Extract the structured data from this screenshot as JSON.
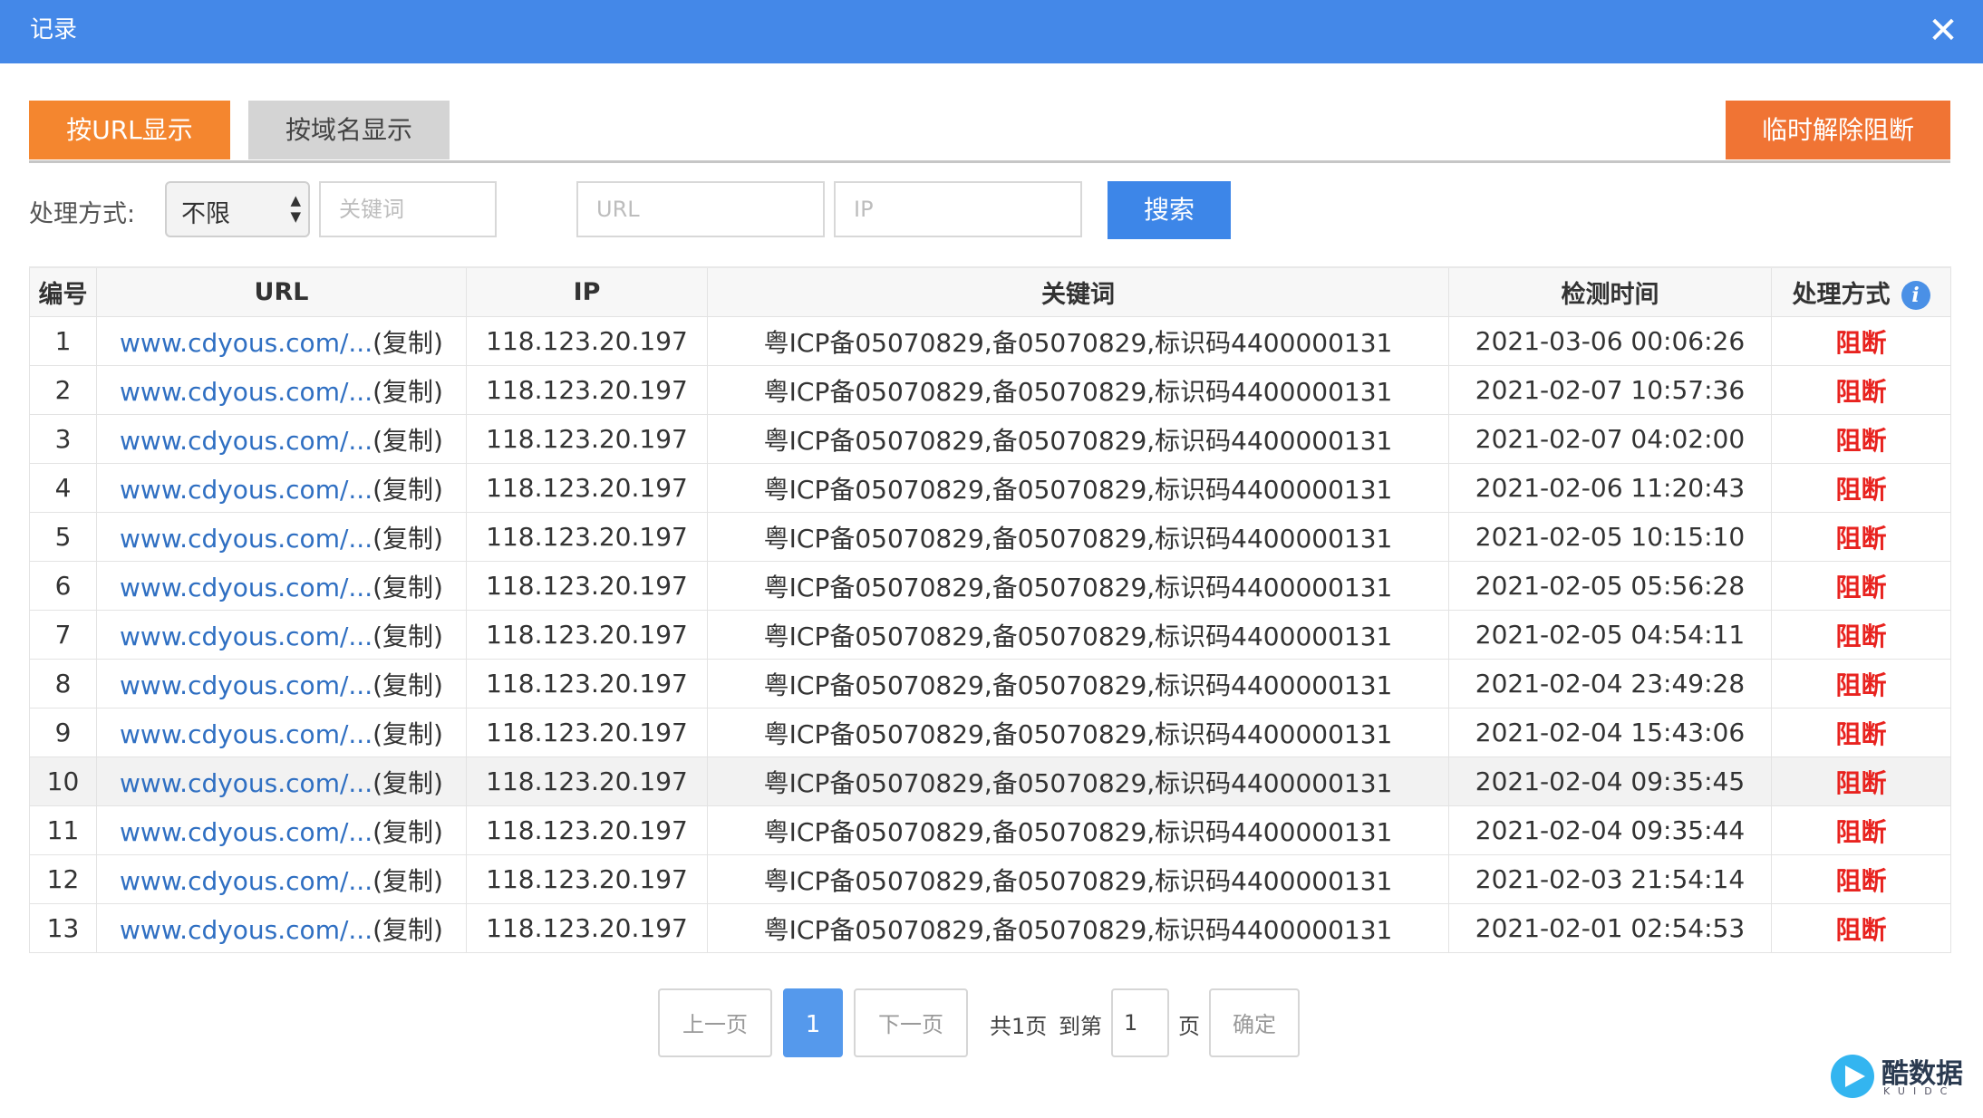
{
  "dialog": {
    "title": "记录",
    "close_icon": "close-icon"
  },
  "tabs": [
    {
      "label": "按URL显示",
      "active": true
    },
    {
      "label": "按域名显示",
      "active": false
    }
  ],
  "unblock_label": "临时解除阻断",
  "filters": {
    "label": "处理方式:",
    "select_value": "不限",
    "keyword_placeholder": "关键词",
    "url_placeholder": "URL",
    "ip_placeholder": "IP",
    "search_label": "搜索"
  },
  "table": {
    "columns": [
      "编号",
      "URL",
      "IP",
      "关键词",
      "检测时间",
      "处理方式"
    ],
    "info_icon": "info-icon",
    "rows": [
      {
        "id": "1",
        "url": "www.cdyous.com/...",
        "copy": "(复制)",
        "ip": "118.123.20.197",
        "keyword": "粤ICP备05070829,备05070829,标识码4400000131",
        "time": "2021-03-06 00:06:26",
        "action": "阻断"
      },
      {
        "id": "2",
        "url": "www.cdyous.com/...",
        "copy": "(复制)",
        "ip": "118.123.20.197",
        "keyword": "粤ICP备05070829,备05070829,标识码4400000131",
        "time": "2021-02-07 10:57:36",
        "action": "阻断"
      },
      {
        "id": "3",
        "url": "www.cdyous.com/...",
        "copy": "(复制)",
        "ip": "118.123.20.197",
        "keyword": "粤ICP备05070829,备05070829,标识码4400000131",
        "time": "2021-02-07 04:02:00",
        "action": "阻断"
      },
      {
        "id": "4",
        "url": "www.cdyous.com/...",
        "copy": "(复制)",
        "ip": "118.123.20.197",
        "keyword": "粤ICP备05070829,备05070829,标识码4400000131",
        "time": "2021-02-06 11:20:43",
        "action": "阻断"
      },
      {
        "id": "5",
        "url": "www.cdyous.com/...",
        "copy": "(复制)",
        "ip": "118.123.20.197",
        "keyword": "粤ICP备05070829,备05070829,标识码4400000131",
        "time": "2021-02-05 10:15:10",
        "action": "阻断"
      },
      {
        "id": "6",
        "url": "www.cdyous.com/...",
        "copy": "(复制)",
        "ip": "118.123.20.197",
        "keyword": "粤ICP备05070829,备05070829,标识码4400000131",
        "time": "2021-02-05 05:56:28",
        "action": "阻断"
      },
      {
        "id": "7",
        "url": "www.cdyous.com/...",
        "copy": "(复制)",
        "ip": "118.123.20.197",
        "keyword": "粤ICP备05070829,备05070829,标识码4400000131",
        "time": "2021-02-05 04:54:11",
        "action": "阻断"
      },
      {
        "id": "8",
        "url": "www.cdyous.com/...",
        "copy": "(复制)",
        "ip": "118.123.20.197",
        "keyword": "粤ICP备05070829,备05070829,标识码4400000131",
        "time": "2021-02-04 23:49:28",
        "action": "阻断"
      },
      {
        "id": "9",
        "url": "www.cdyous.com/...",
        "copy": "(复制)",
        "ip": "118.123.20.197",
        "keyword": "粤ICP备05070829,备05070829,标识码4400000131",
        "time": "2021-02-04 15:43:06",
        "action": "阻断"
      },
      {
        "id": "10",
        "url": "www.cdyous.com/...",
        "copy": "(复制)",
        "ip": "118.123.20.197",
        "keyword": "粤ICP备05070829,备05070829,标识码4400000131",
        "time": "2021-02-04 09:35:45",
        "action": "阻断"
      },
      {
        "id": "11",
        "url": "www.cdyous.com/...",
        "copy": "(复制)",
        "ip": "118.123.20.197",
        "keyword": "粤ICP备05070829,备05070829,标识码4400000131",
        "time": "2021-02-04 09:35:44",
        "action": "阻断"
      },
      {
        "id": "12",
        "url": "www.cdyous.com/...",
        "copy": "(复制)",
        "ip": "118.123.20.197",
        "keyword": "粤ICP备05070829,备05070829,标识码4400000131",
        "time": "2021-02-03 21:54:14",
        "action": "阻断"
      },
      {
        "id": "13",
        "url": "www.cdyous.com/...",
        "copy": "(复制)",
        "ip": "118.123.20.197",
        "keyword": "粤ICP备05070829,备05070829,标识码4400000131",
        "time": "2021-02-01 02:54:53",
        "action": "阻断"
      }
    ]
  },
  "pagination": {
    "prev_label": "上一页",
    "current_page": "1",
    "next_label": "下一页",
    "total_label": "共1页",
    "goto_label": "到第",
    "goto_value": "1",
    "page_suffix": "页",
    "confirm_label": "确定"
  },
  "watermark": {
    "name": "酷数据",
    "sub": "KUIDC"
  },
  "colors": {
    "titlebar": "#4488e8",
    "tab_active": "#f4862f",
    "unblock": "#f07434",
    "search": "#3d86e8",
    "link": "#2f6fc2",
    "action": "#e8231f"
  }
}
